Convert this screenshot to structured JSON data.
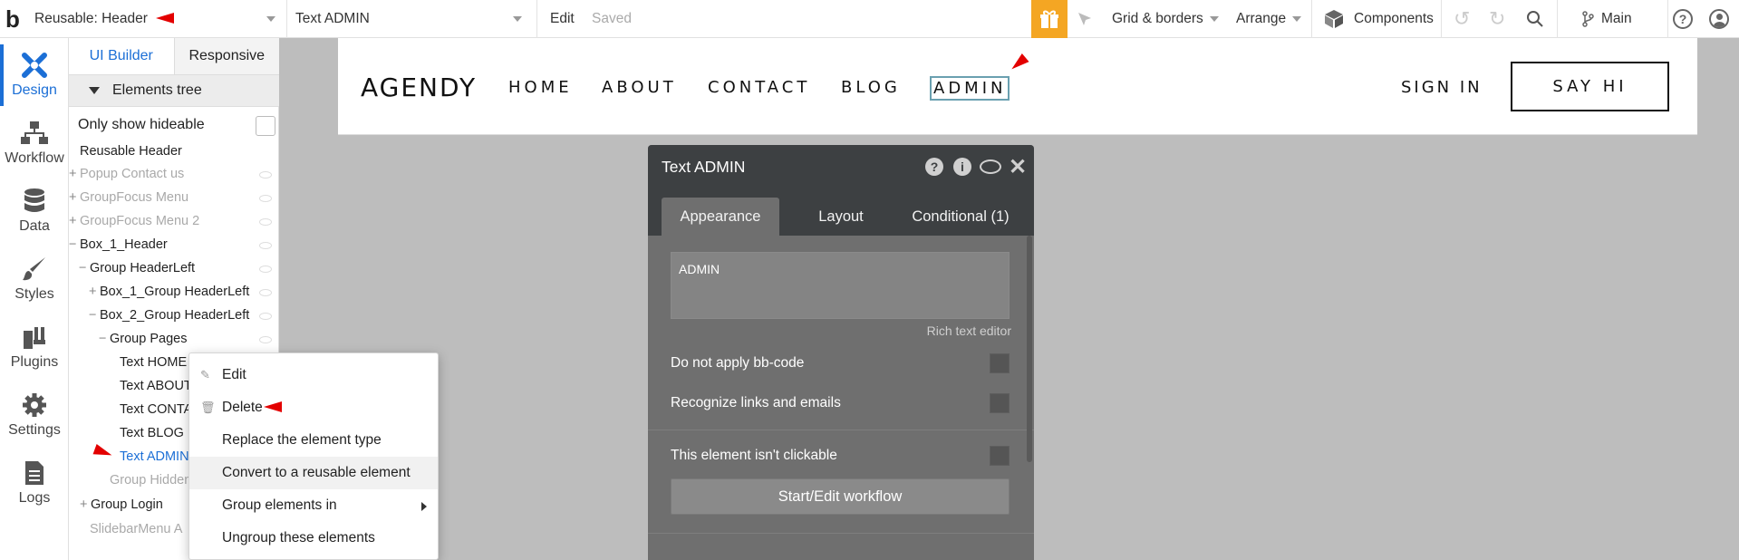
{
  "topbar": {
    "logo": "b",
    "page_selector": "Reusable: Header",
    "element_selector": "Text ADMIN",
    "edit": "Edit",
    "saved": "Saved",
    "grid_borders": "Grid & borders",
    "arrange": "Arrange",
    "components": "Components",
    "branch": "Main",
    "gift_color": "#f4a623"
  },
  "leftnav": {
    "items": [
      {
        "label": "Design",
        "icon": "design-icon"
      },
      {
        "label": "Workflow",
        "icon": "workflow-icon"
      },
      {
        "label": "Data",
        "icon": "database-icon"
      },
      {
        "label": "Styles",
        "icon": "brush-icon"
      },
      {
        "label": "Plugins",
        "icon": "plugin-icon"
      },
      {
        "label": "Settings",
        "icon": "gear-icon"
      },
      {
        "label": "Logs",
        "icon": "logs-icon"
      }
    ]
  },
  "panel": {
    "tab_ui_builder": "UI Builder",
    "tab_responsive": "Responsive",
    "elements_tree": "Elements tree",
    "only_show_hideable": "Only show hideable",
    "tree": [
      {
        "label": "Reusable Header",
        "pm": ""
      },
      {
        "label": "Popup Contact us",
        "pm": "+"
      },
      {
        "label": "GroupFocus Menu",
        "pm": "+"
      },
      {
        "label": "GroupFocus Menu 2",
        "pm": "+"
      },
      {
        "label": "Box_1_Header",
        "pm": "−"
      },
      {
        "label": "Group HeaderLeft",
        "pm": "−"
      },
      {
        "label": "Box_1_Group HeaderLeft",
        "pm": "+"
      },
      {
        "label": "Box_2_Group HeaderLeft",
        "pm": "−"
      },
      {
        "label": "Group Pages",
        "pm": "−"
      },
      {
        "label": "Text HOME",
        "pm": ""
      },
      {
        "label": "Text ABOUT",
        "pm": ""
      },
      {
        "label": "Text CONTA",
        "pm": ""
      },
      {
        "label": "Text BLOG",
        "pm": ""
      },
      {
        "label": "Text ADMIN",
        "pm": ""
      },
      {
        "label": "Group Hidden",
        "pm": ""
      },
      {
        "label": "Group Login",
        "pm": "+"
      },
      {
        "label": "SlidebarMenu A",
        "pm": ""
      }
    ]
  },
  "canvas": {
    "logo": "AGENDY",
    "nav": [
      "HOME",
      "ABOUT",
      "CONTACT",
      "BLOG",
      "ADMIN"
    ],
    "sign_in": "SIGN IN",
    "say_hi": "SAY HI"
  },
  "props": {
    "title": "Text ADMIN",
    "tabs": [
      "Appearance",
      "Layout",
      "Conditional (1)"
    ],
    "text_value": "ADMIN",
    "rich_text_editor": "Rich text editor",
    "do_not_apply_bbcode": "Do not apply bb-code",
    "recognize_links": "Recognize links and emails",
    "not_clickable": "This element isn't clickable",
    "workflow_button": "Start/Edit workflow"
  },
  "context_menu": {
    "items": [
      "Edit",
      "Delete",
      "Replace the element type",
      "Convert to a reusable element",
      "Group elements in",
      "Ungroup these elements"
    ]
  }
}
